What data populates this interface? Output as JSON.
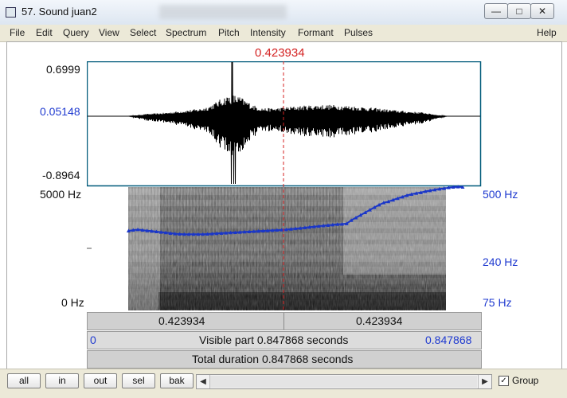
{
  "window": {
    "title": "57. Sound juan2",
    "minimize_glyph": "—",
    "maximize_glyph": "□",
    "close_glyph": "✕"
  },
  "menu": {
    "items": [
      "File",
      "Edit",
      "Query",
      "View",
      "Select",
      "Spectrum",
      "Pitch",
      "Intensity",
      "Formant",
      "Pulses"
    ],
    "help": "Help"
  },
  "cursor": {
    "time_label": "0.423934"
  },
  "waveform": {
    "max_label": "0.6999",
    "mid_label": "0.05148",
    "min_label": "-0.8964"
  },
  "spectrogram": {
    "top_freq_label": "5000 Hz",
    "bottom_freq_label": "0 Hz"
  },
  "pitch_axis": {
    "top_label": "500 Hz",
    "mid_label": "240 Hz",
    "bottom_label": "75 Hz"
  },
  "time_bars": {
    "left_segment": "0.423934",
    "right_segment": "0.423934",
    "visible_start": "0",
    "visible_text": "Visible part 0.847868 seconds",
    "visible_end": "0.847868",
    "total_text": "Total duration 0.847868 seconds"
  },
  "controls": {
    "buttons": [
      "all",
      "in",
      "out",
      "sel",
      "bak"
    ],
    "scroll_left": "◀",
    "scroll_right": "▶",
    "group_label": "Group",
    "group_checked": true,
    "check_glyph": "✓"
  },
  "colors": {
    "waveform": "#000000",
    "pitch": "#1a36c8",
    "cursor": "#d42222",
    "label_blue": "#1f3ad0"
  },
  "chart_data": {
    "type": "line",
    "x_range": [
      0,
      0.847868
    ],
    "cursor_time": 0.423934,
    "pitch_range_hz": [
      75,
      500
    ],
    "pitch_track": {
      "x": [
        0.09,
        0.1,
        0.11,
        0.12,
        0.13,
        0.14,
        0.15,
        0.16,
        0.17,
        0.18,
        0.19,
        0.2,
        0.21,
        0.22,
        0.23,
        0.24,
        0.25,
        0.26,
        0.27,
        0.28,
        0.29,
        0.3,
        0.31,
        0.32,
        0.33,
        0.34,
        0.35,
        0.36,
        0.37,
        0.38,
        0.39,
        0.4,
        0.41,
        0.42,
        0.43,
        0.44,
        0.45,
        0.46,
        0.47,
        0.48,
        0.49,
        0.5,
        0.51,
        0.52,
        0.53,
        0.54,
        0.55,
        0.56,
        0.57,
        0.58,
        0.59,
        0.6,
        0.61,
        0.62,
        0.63,
        0.64,
        0.65,
        0.66,
        0.67,
        0.68,
        0.69,
        0.7,
        0.71,
        0.72,
        0.73,
        0.74,
        0.75,
        0.76,
        0.77,
        0.78,
        0.79,
        0.8,
        0.81
      ],
      "y": [
        255,
        258,
        260,
        258,
        256,
        254,
        252,
        250,
        248,
        246,
        244,
        243,
        242,
        242,
        242,
        242,
        242,
        243,
        244,
        245,
        246,
        247,
        248,
        249,
        250,
        251,
        252,
        253,
        254,
        255,
        256,
        257,
        258,
        259,
        260,
        262,
        264,
        266,
        268,
        270,
        272,
        274,
        276,
        278,
        280,
        282,
        283,
        285,
        300,
        312,
        325,
        338,
        352,
        366,
        380,
        393,
        400,
        410,
        420,
        430,
        440,
        448,
        455,
        460,
        468,
        474,
        480,
        486,
        490,
        496,
        500,
        502,
        500
      ],
      "unit": "Hz"
    }
  }
}
